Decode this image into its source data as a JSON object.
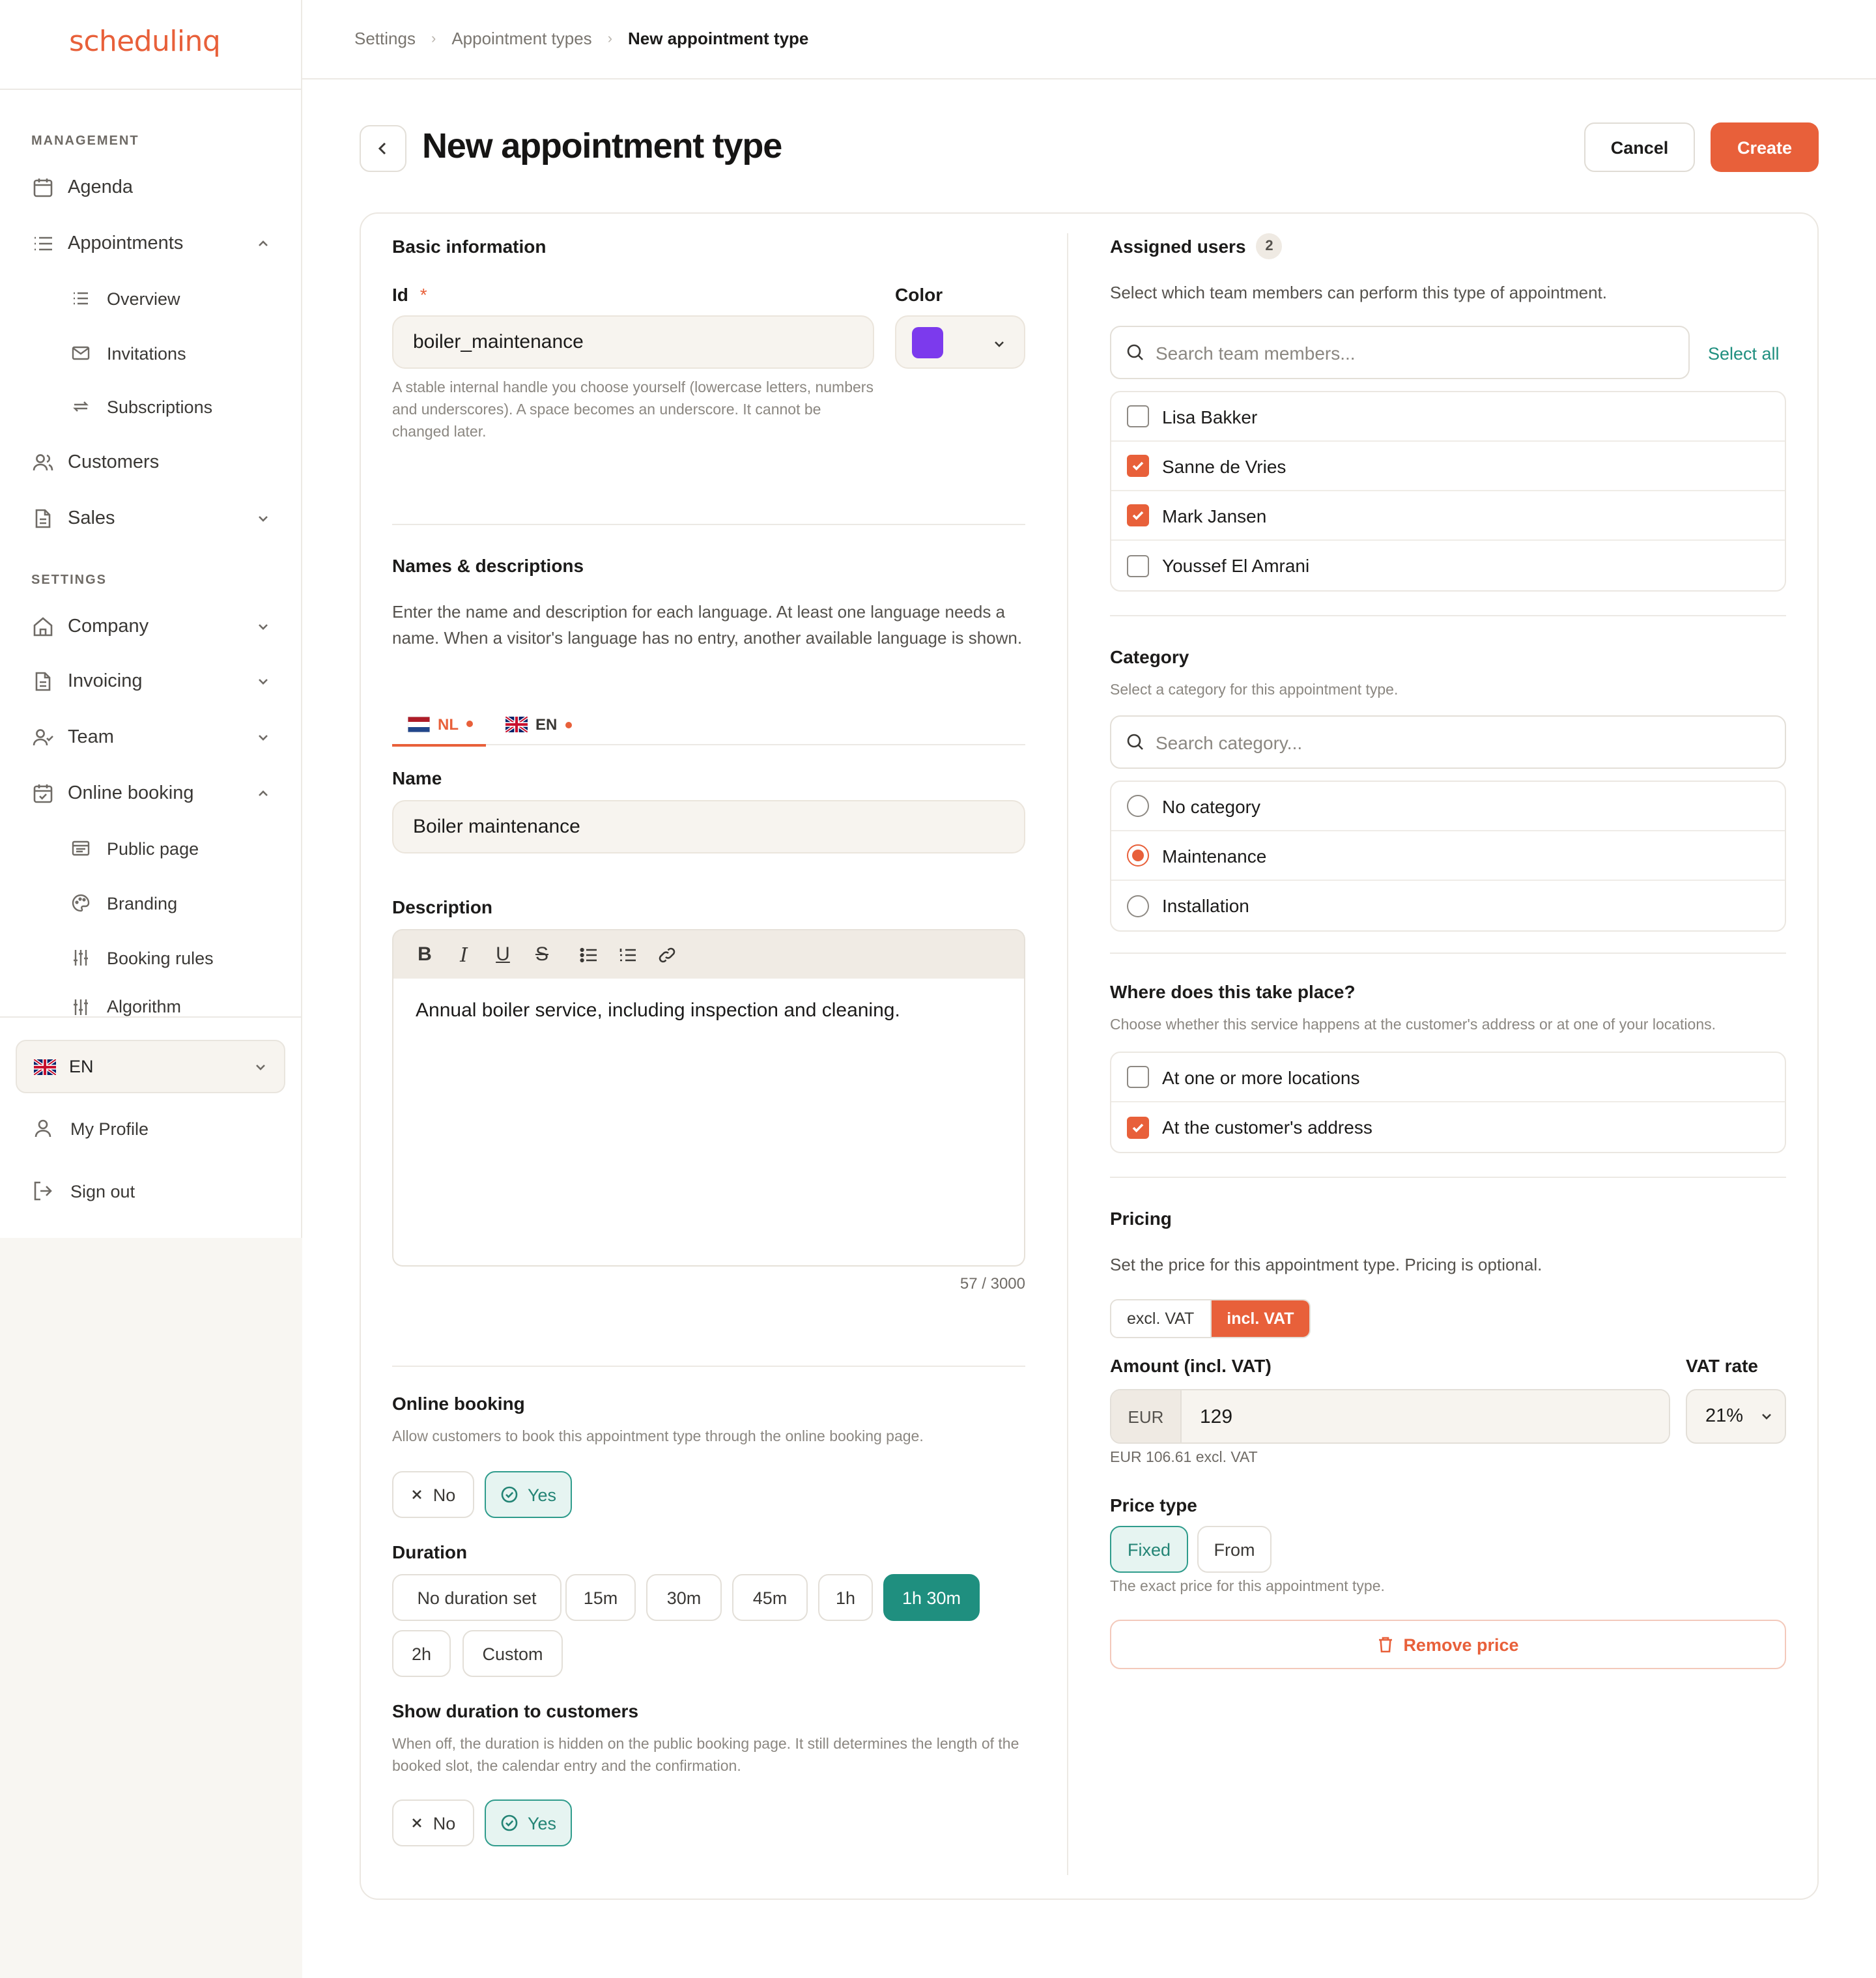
{
  "brand": {
    "logo": "schedulinq",
    "accent": "#e8603a",
    "teal": "#1f8f7f"
  },
  "sidebar": {
    "management_label": "MANAGEMENT",
    "settings_label": "SETTINGS",
    "items": [
      {
        "label": "Agenda",
        "icon": "calendar-icon"
      },
      {
        "label": "Appointments",
        "icon": "list-icon",
        "expanded": true
      },
      {
        "label": "Overview",
        "icon": "list-icon"
      },
      {
        "label": "Invitations",
        "icon": "mail-icon"
      },
      {
        "label": "Subscriptions",
        "icon": "repeat-icon"
      },
      {
        "label": "Customers",
        "icon": "users-icon"
      },
      {
        "label": "Sales",
        "icon": "document-icon"
      },
      {
        "label": "Company",
        "icon": "home-icon"
      },
      {
        "label": "Invoicing",
        "icon": "document-icon"
      },
      {
        "label": "Team",
        "icon": "user-check-icon"
      },
      {
        "label": "Online booking",
        "icon": "calendar-check-icon",
        "expanded": true
      },
      {
        "label": "Public page",
        "icon": "browser-icon"
      },
      {
        "label": "Branding",
        "icon": "palette-icon"
      },
      {
        "label": "Booking rules",
        "icon": "sliders-icon"
      },
      {
        "label": "Algorithm",
        "icon": "sliders-icon"
      }
    ],
    "language": "EN",
    "my_profile": "My Profile",
    "sign_out": "Sign out"
  },
  "breadcrumb": [
    "Settings",
    "Appointment types",
    "New appointment type"
  ],
  "header": {
    "title": "New appointment type",
    "cancel": "Cancel",
    "create": "Create"
  },
  "basic": {
    "title": "Basic information",
    "id_label": "Id",
    "required_mark": "*",
    "id_value": "boiler_maintenance",
    "id_help": "A stable internal handle you choose yourself (lowercase letters, numbers and underscores). A space becomes an underscore. It cannot be changed later.",
    "color_label": "Color",
    "color_value": "#7c3aed"
  },
  "names": {
    "title": "Names & descriptions",
    "desc": "Enter the name and description for each language. At least one language needs a name. When a visitor's language has no entry, another available language is shown.",
    "tabs": [
      "NL",
      "EN"
    ],
    "name_label": "Name",
    "name_value": "Boiler maintenance",
    "description_label": "Description",
    "description_value": "Annual boiler service, including inspection and cleaning.",
    "char_count": "57 / 3000"
  },
  "online_booking": {
    "title": "Online booking",
    "help": "Allow customers to book this appointment type through the online booking page.",
    "no": "No",
    "yes": "Yes"
  },
  "duration": {
    "title": "Duration",
    "options": [
      "No duration set",
      "15m",
      "30m",
      "45m",
      "1h",
      "1h 30m",
      "2h",
      "Custom"
    ],
    "selected": "1h 30m"
  },
  "show_duration": {
    "title": "Show duration to customers",
    "help": "When off, the duration is hidden on the public booking page. It still determines the length of the booked slot, the calendar entry and the confirmation.",
    "no": "No",
    "yes": "Yes"
  },
  "assigned": {
    "title": "Assigned users",
    "count": "2",
    "desc": "Select which team members can perform this type of appointment.",
    "search_placeholder": "Search team members...",
    "select_all": "Select all",
    "users": [
      {
        "name": "Lisa Bakker",
        "checked": false
      },
      {
        "name": "Sanne de Vries",
        "checked": true
      },
      {
        "name": "Mark Jansen",
        "checked": true
      },
      {
        "name": "Youssef El Amrani",
        "checked": false
      }
    ]
  },
  "category": {
    "title": "Category",
    "help": "Select a category for this appointment type.",
    "search_placeholder": "Search category...",
    "options": [
      {
        "name": "No category",
        "selected": false
      },
      {
        "name": "Maintenance",
        "selected": true
      },
      {
        "name": "Installation",
        "selected": false
      }
    ]
  },
  "location": {
    "title": "Where does this take place?",
    "help": "Choose whether this service happens at the customer's address or at one of your locations.",
    "options": [
      {
        "name": "At one or more locations",
        "checked": false
      },
      {
        "name": "At the customer's address",
        "checked": true
      }
    ]
  },
  "pricing": {
    "title": "Pricing",
    "desc": "Set the price for this appointment type. Pricing is optional.",
    "excl": "excl. VAT",
    "incl": "incl. VAT",
    "amount_label": "Amount (incl. VAT)",
    "currency": "EUR",
    "amount": "129",
    "vat_label": "VAT rate",
    "vat": "21%",
    "excl_note": "EUR 106.61 excl. VAT",
    "price_type_label": "Price type",
    "fixed": "Fixed",
    "from": "From",
    "price_type_help": "The exact price for this appointment type.",
    "remove": "Remove price"
  }
}
